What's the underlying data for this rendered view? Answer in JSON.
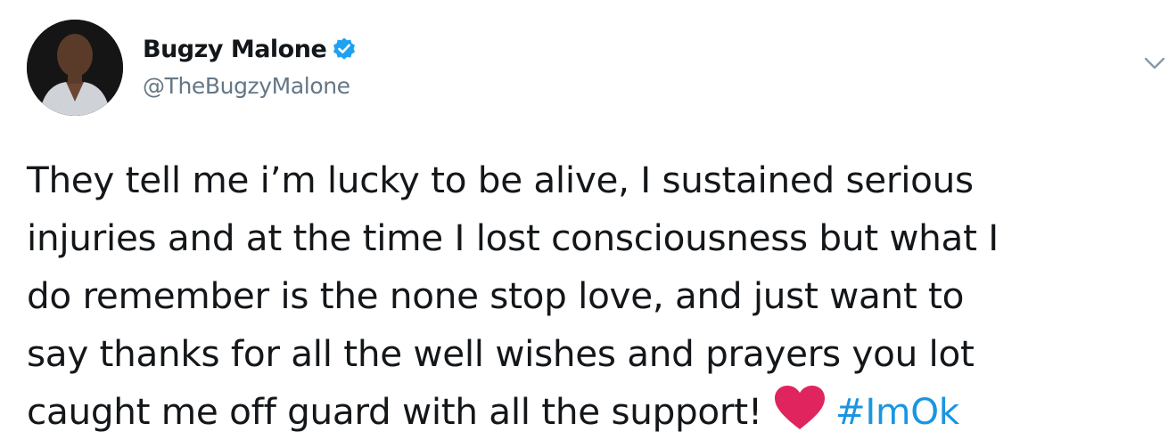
{
  "tweet": {
    "author": {
      "display_name": "Bugzy Malone",
      "handle": "@TheBugzyMalone",
      "verified": true,
      "verified_icon": "verified-badge-icon"
    },
    "menu_icon": "chevron-down-icon",
    "text_lines": [
      "They tell me i’m lucky to be alive, I sustained serious",
      "injuries and at the time I lost consciousness but what I",
      "do remember is the none stop love, and just want to",
      "say thanks for all the well wishes and prayers you lot",
      "caught me off guard with all the support!"
    ],
    "emoji": "heart-icon",
    "hashtag": "#ImOk"
  },
  "colors": {
    "text": "#14171a",
    "secondary": "#657786",
    "link": "#1b95e0",
    "verified": "#1da1f2",
    "heart": "#e0245e"
  }
}
